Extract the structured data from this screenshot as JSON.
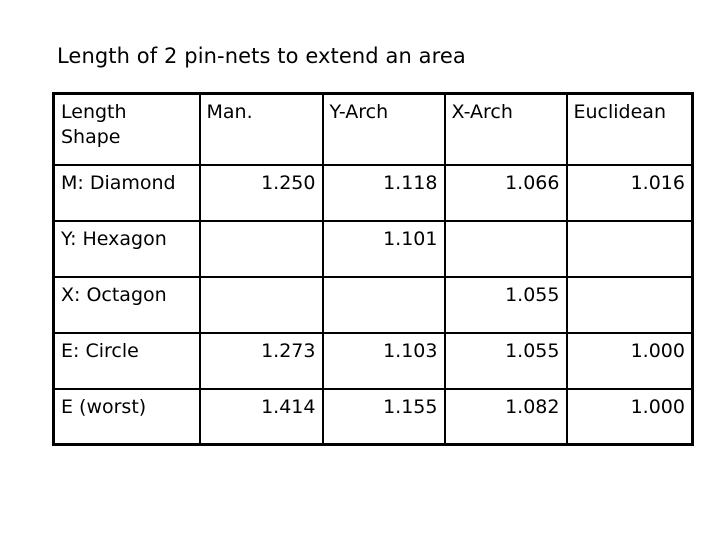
{
  "slide": {
    "title": "Length of 2 pin-nets to extend an area"
  },
  "table": {
    "headers": {
      "corner_line1": "Length",
      "corner_line2": "Shape",
      "col1": "Man.",
      "col2": "Y-Arch",
      "col3": "X-Arch",
      "col4": "Euclidean"
    },
    "rows": [
      {
        "label": "M: Diamond",
        "man": "1.250",
        "yarch": "1.118",
        "xarch": "1.066",
        "euclidean": "1.016"
      },
      {
        "label": "Y: Hexagon",
        "man": "",
        "yarch": "1.101",
        "xarch": "",
        "euclidean": ""
      },
      {
        "label": "X: Octagon",
        "man": "",
        "yarch": "",
        "xarch": "1.055",
        "euclidean": ""
      },
      {
        "label": "E: Circle",
        "man": "1.273",
        "yarch": "1.103",
        "xarch": "1.055",
        "euclidean": "1.000"
      },
      {
        "label": "E (worst)",
        "man": "1.414",
        "yarch": "1.155",
        "xarch": "1.082",
        "euclidean": "1.000"
      }
    ]
  },
  "colors": {
    "background": "#ffffff",
    "text": "#000000",
    "border": "#000000"
  }
}
